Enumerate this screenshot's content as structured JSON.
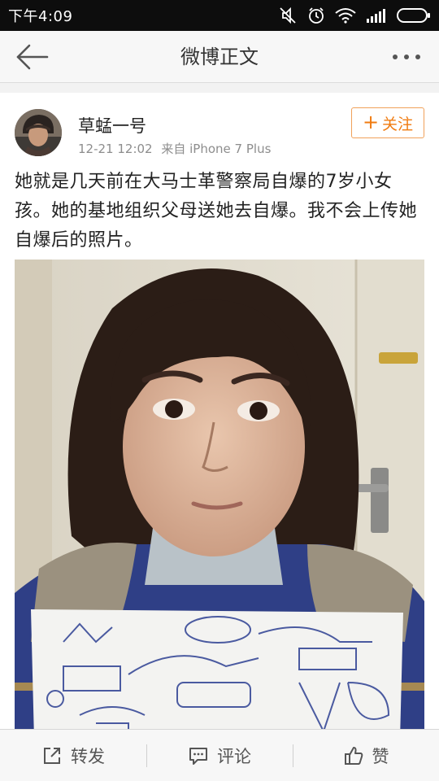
{
  "status_bar": {
    "time": "下午4:09",
    "icons": [
      "mute-icon",
      "alarm-icon",
      "wifi-icon",
      "signal-icon",
      "battery-icon"
    ]
  },
  "nav": {
    "title": "微博正文",
    "back_icon": "back-arrow-icon",
    "more_icon": "more-dots-icon"
  },
  "post": {
    "username": "草蜢一号",
    "time": "12-21 12:02",
    "source": "来自 iPhone 7 Plus",
    "follow_label": "关注",
    "text": "她就是几天前在大马士革警察局自爆的7岁小女孩。她的基地组织父母送她去自爆。我不会上传她自爆后的照片。"
  },
  "actions": {
    "repost_label": "转发",
    "comment_label": "评论",
    "like_label": "赞"
  },
  "colors": {
    "accent": "#f07b10",
    "status_bar_bg": "#0d0d0d",
    "text": "#222222",
    "meta": "#8d8d8d"
  }
}
